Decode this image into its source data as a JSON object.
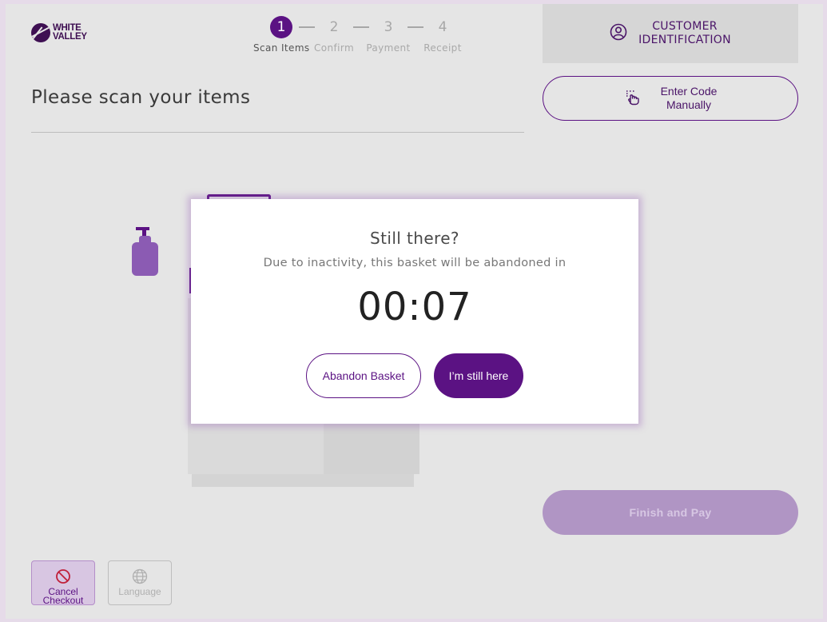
{
  "brand": {
    "logo_line1": "WHITE",
    "logo_line2": "VALLEY"
  },
  "stepper": {
    "steps": [
      {
        "number": "1",
        "label": "Scan Items"
      },
      {
        "number": "2",
        "label": "Confirm"
      },
      {
        "number": "3",
        "label": "Payment"
      },
      {
        "number": "4",
        "label": "Receipt"
      }
    ]
  },
  "customer_id": {
    "line1": "CUSTOMER",
    "line2": "IDENTIFICATION",
    "icon": "user-circle-icon"
  },
  "enter_code": {
    "line1": "Enter Code",
    "line2": "Manually",
    "icon": "tap-hand-icon"
  },
  "main": {
    "title": "Please scan your items"
  },
  "finish_pay": {
    "label": "Finish and Pay"
  },
  "footer": {
    "cancel": {
      "line1": "Cancel",
      "line2": "Checkout",
      "icon": "prohibit-icon"
    },
    "language": {
      "label": "Language",
      "icon": "globe-icon"
    }
  },
  "modal": {
    "title": "Still there?",
    "message": "Due to inactivity, this basket will be abandoned in",
    "countdown": "00:07",
    "abandon_label": "Abandon Basket",
    "stay_label": "I’m still here"
  },
  "colors": {
    "accent": "#5b1283",
    "background": "#e5e5e5",
    "disabled_button": "#b095c4"
  }
}
